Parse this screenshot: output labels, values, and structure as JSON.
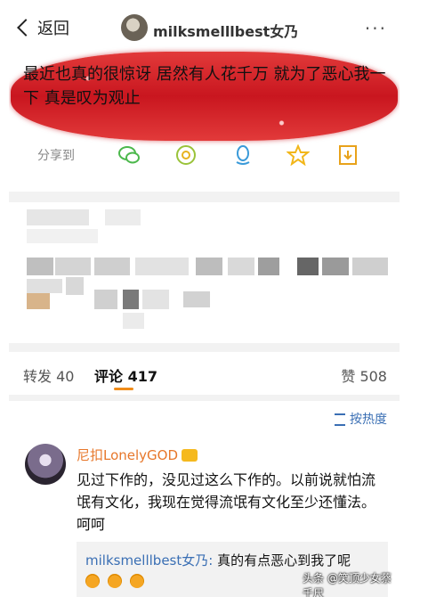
{
  "nav": {
    "back_label": "返回",
    "title": "milksmelllbest女乃",
    "more": "···"
  },
  "post": {
    "text": "最近也真的很惊讶 居然有人花千万 就为了恶心我一下 真是叹为观止"
  },
  "share": {
    "label": "分享到",
    "icons": [
      "wechat-icon",
      "moments-icon",
      "qq-icon",
      "qzone-icon",
      "save-icon"
    ]
  },
  "tabs": {
    "repost": "转发 40",
    "comment": "评论 417",
    "like": "赞 508"
  },
  "sort": {
    "label": "按热度"
  },
  "comment": {
    "user": "尼扣LonelyGOD",
    "text": "见过下作的，没见过这么下作的。以前说就怕流氓有文化，我现在觉得流氓有文化至少还懂法。呵呵",
    "reply_user": "milksmelllbest女乃:",
    "reply_text": " 真的有点恶心到我了呢"
  },
  "colors": {
    "accent": "#f08c1a",
    "link": "#3a6fb4",
    "glitter": "#c9161f"
  },
  "watermark": "头条 @笑顶少女蔡千尺"
}
